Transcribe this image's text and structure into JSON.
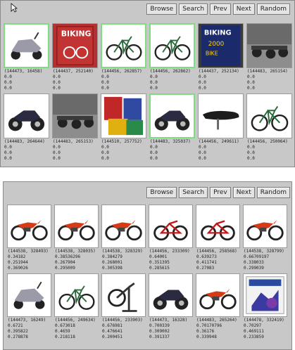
{
  "toolbar": {
    "browse": "Browse",
    "search": "Search",
    "prev": "Prev",
    "next": "Next",
    "random": "Random"
  },
  "top_panel": {
    "items": [
      {
        "id": "(144473, 16458)",
        "s1": "0.0",
        "s2": "0.0",
        "s3": "0.0",
        "icon": "scooter-icon",
        "selected": true
      },
      {
        "id": "(144437, 252140)",
        "s1": "0.0",
        "s2": "0.0",
        "s3": "0.0",
        "icon": "magazine-biking-icon",
        "selected": false
      },
      {
        "id": "(144456, 262857)",
        "s1": "0.0",
        "s2": "0.0",
        "s3": "0.0",
        "icon": "bicycle-icon",
        "selected": true
      },
      {
        "id": "(144456, 262862)",
        "s1": "0.0",
        "s2": "0.0",
        "s3": "0.0",
        "icon": "bicycle-icon",
        "selected": true
      },
      {
        "id": "(144437, 252134)",
        "s1": "0.0",
        "s2": "0.0",
        "s3": "0.0",
        "icon": "magazine-bike-of-year-icon",
        "selected": false
      },
      {
        "id": "(144483, 265154)",
        "s1": "0.0",
        "s2": "0.0",
        "s3": "0.0",
        "icon": "motorcycle-lot-icon",
        "selected": false
      },
      {
        "id": "(144483, 264644)",
        "s1": "0.0",
        "s2": "0.0",
        "s3": "0.0",
        "icon": "motorcycle-icon",
        "selected": false
      },
      {
        "id": "(144483, 265153)",
        "s1": "0.0",
        "s2": "0.0",
        "s3": "0.0",
        "icon": "motorcycle-lot-icon",
        "selected": false
      },
      {
        "id": "(144510, 257752)",
        "s1": "0.0",
        "s2": "0.0",
        "s3": "0.0",
        "icon": "magazine-stack-icon",
        "selected": false
      },
      {
        "id": "(144483, 325037)",
        "s1": "0.0",
        "s2": "0.0",
        "s3": "0.0",
        "icon": "motorcycle-icon",
        "selected": true
      },
      {
        "id": "(144456, 249611)",
        "s1": "0.0",
        "s2": "0.0",
        "s3": "0.0",
        "icon": "bike-seat-icon",
        "selected": false
      },
      {
        "id": "(144456, 250064)",
        "s1": "0.0",
        "s2": "0.0",
        "s3": "0.0",
        "icon": "bicycle-icon",
        "selected": false
      }
    ]
  },
  "bottom_panel": {
    "items": [
      {
        "id": "(144538, 328493)",
        "s1": "0.34182",
        "s2": "0.251944",
        "s3": "0.369026",
        "icon": "dirt-bike-icon"
      },
      {
        "id": "(144538, 328035)",
        "s1": "0.38536296",
        "s2": "0.267904",
        "s3": "0.295009",
        "icon": "dirt-bike-icon"
      },
      {
        "id": "(144538, 328329)",
        "s1": "0.384279",
        "s2": "0.268001",
        "s3": "0.305398",
        "icon": "dirt-bike-icon"
      },
      {
        "id": "(144456, 233309)",
        "s1": "0.64001",
        "s2": "0.351395",
        "s3": "0.285615",
        "icon": "bmx-bike-icon"
      },
      {
        "id": "(144456, 258568)",
        "s1": "0.639273",
        "s2": "0.411741",
        "s3": "0.27083",
        "icon": "bmx-bike-icon"
      },
      {
        "id": "(144538, 328799)",
        "s1": "0.66709197",
        "s2": "0.338033",
        "s3": "0.299039",
        "icon": "dirt-bike-icon"
      },
      {
        "id": "(144473, 16249)",
        "s1": "0.6721",
        "s2": "0.395822",
        "s3": "0.278878",
        "icon": "scooter-icon"
      },
      {
        "id": "(144456, 249634)",
        "s1": "0.673018",
        "s2": "0.4659",
        "s3": "0.218118",
        "icon": "bicycle-icon"
      },
      {
        "id": "(144456, 233903)",
        "s1": "0.676981",
        "s2": "0.476641",
        "s3": "0.200451",
        "icon": "exercise-bike-icon"
      },
      {
        "id": "(144473, 16328)",
        "s1": "0.700339",
        "s2": "0.309002",
        "s3": "0.391337",
        "icon": "motorcycle-icon"
      },
      {
        "id": "(144483, 265264)",
        "s1": "0.70170796",
        "s2": "0.36176",
        "s3": "0.339948",
        "icon": "dirt-bike-icon"
      },
      {
        "id": "(144478, 332419)",
        "s1": "0.70297",
        "s2": "0.469111",
        "s3": "0.233859",
        "icon": "poster-icon"
      }
    ]
  }
}
